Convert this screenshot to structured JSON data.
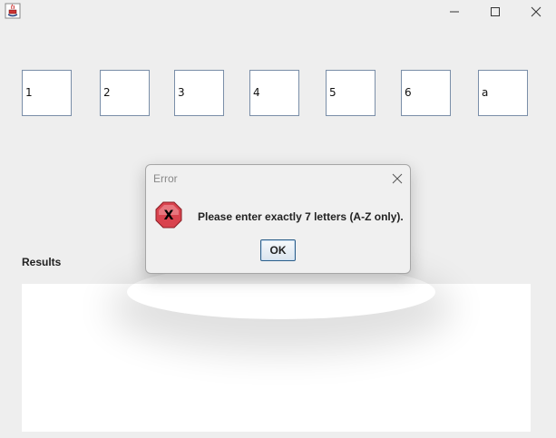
{
  "window": {
    "icon": "java-icon",
    "controls": [
      "minimize-icon",
      "maximize-icon",
      "close-icon"
    ]
  },
  "inputs": [
    {
      "value": "1"
    },
    {
      "value": "2"
    },
    {
      "value": "3"
    },
    {
      "value": "4"
    },
    {
      "value": "5"
    },
    {
      "value": "6"
    },
    {
      "value": "a"
    }
  ],
  "results": {
    "label": "Results",
    "content": ""
  },
  "dialog": {
    "title": "Error",
    "message": "Please enter exactly 7 letters (A-Z only).",
    "ok_label": "OK",
    "icon": "error-icon",
    "error_color": "#d9434e"
  }
}
